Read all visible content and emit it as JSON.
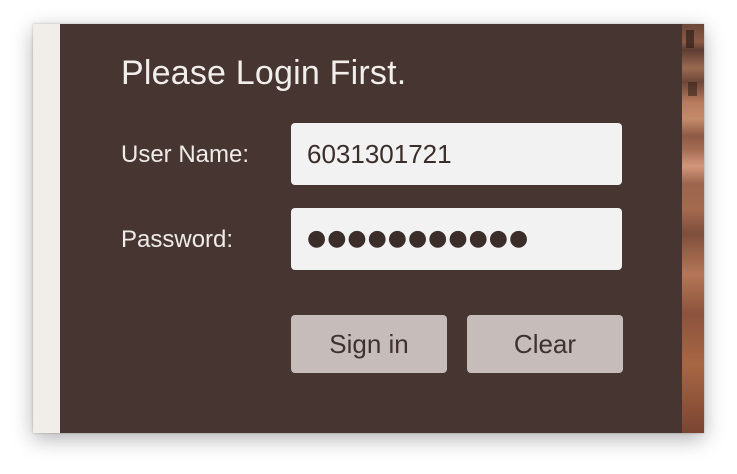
{
  "login": {
    "title": "Please Login First.",
    "username_label": "User Name:",
    "username_value": "6031301721",
    "password_label": "Password:",
    "password_masked": "●●●●●●●●●●●",
    "signin_label": "Sign in",
    "clear_label": "Clear"
  },
  "colors": {
    "panel": "#463530",
    "field": "#f2f2f2",
    "button": "#c6bdbb",
    "left_strip": "#f1eee9"
  }
}
